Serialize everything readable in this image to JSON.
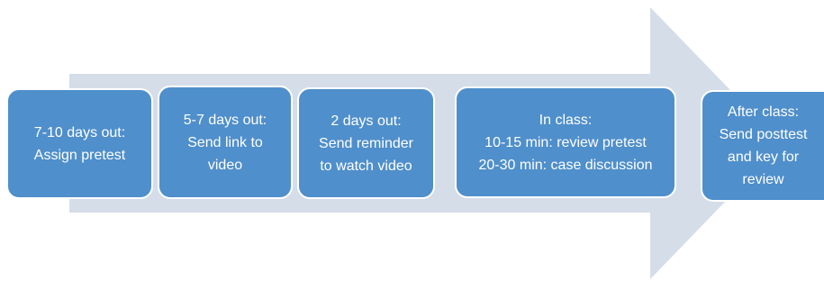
{
  "diagram": {
    "type": "process-arrow",
    "colors": {
      "arrow_fill": "#d5dde9",
      "box_fill": "#4f8fcb",
      "box_border": "#ffffff",
      "text": "#ffffff"
    },
    "steps": [
      {
        "lines": [
          "7-10 days out:",
          "Assign pretest"
        ]
      },
      {
        "lines": [
          "5-7 days out:",
          "Send link to",
          "video"
        ]
      },
      {
        "lines": [
          "2 days out:",
          "Send reminder",
          "to watch video"
        ]
      },
      {
        "lines": [
          "In class:",
          "10-15 min: review pretest",
          "20-30 min: case discussion"
        ]
      },
      {
        "lines": [
          "After class:",
          "Send posttest",
          "and key for",
          "review"
        ]
      }
    ]
  }
}
